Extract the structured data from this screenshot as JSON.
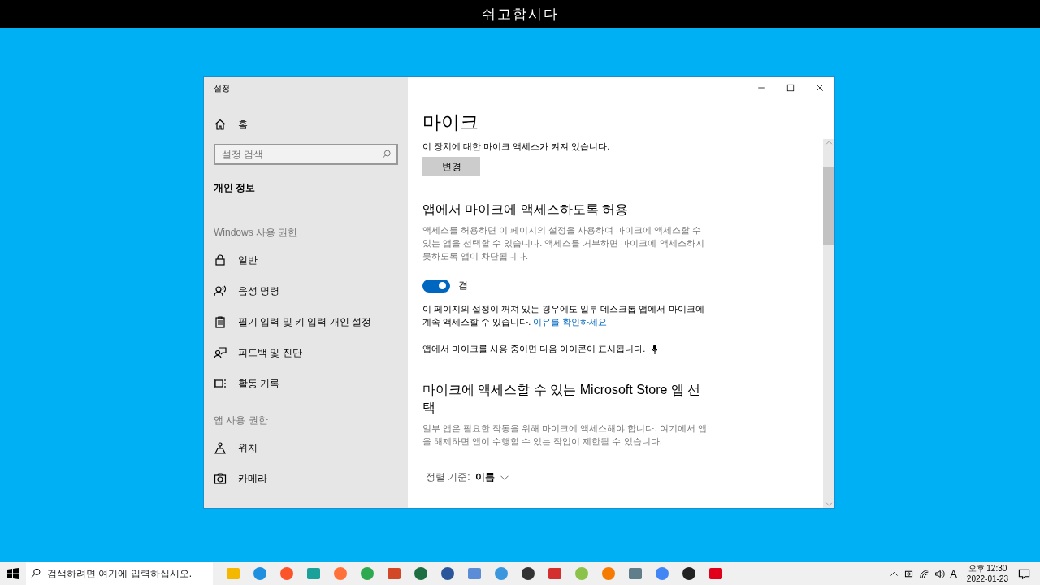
{
  "top_banner": {
    "title": "쉬고합시다"
  },
  "window": {
    "title": "설정",
    "sidebar": {
      "home": {
        "label": "홈",
        "kind": "home"
      },
      "search": {
        "placeholder": "설정 검색"
      },
      "current": "개인 정보",
      "sections": [
        {
          "heading": "Windows 사용 권한",
          "items": [
            {
              "label": "일반",
              "kind": "lock"
            },
            {
              "label": "음성 명령",
              "kind": "speech"
            },
            {
              "label": "필기 입력 및 키 입력 개인 설정",
              "kind": "clipboard"
            },
            {
              "label": "피드백 및 진단",
              "kind": "feedback"
            },
            {
              "label": "활동 기록",
              "kind": "timeline"
            }
          ]
        },
        {
          "heading": "앱 사용 권한",
          "items": [
            {
              "label": "위치",
              "kind": "location"
            },
            {
              "label": "카메라",
              "kind": "camera"
            }
          ]
        }
      ]
    },
    "content": {
      "title": "마이크",
      "device_status": "이 장치에 대한 마이크 액세스가 켜져 있습니다.",
      "change_button": "변경",
      "allow_heading": "앱에서 마이크에 액세스하도록 허용",
      "allow_description": "액세스를 허용하면 이 페이지의 설정을 사용하여 마이크에 액세스할 수 있는 앱을 선택할 수 있습니다. 액세스를 거부하면 마이크에 액세스하지 못하도록 앱이 차단됩니다.",
      "toggle": {
        "on": true,
        "label": "켬"
      },
      "desktop_note": "이 페이지의 설정이 꺼져 있는 경우에도 일부 데스크톱 앱에서 마이크에 계속 액세스할 수 있습니다.",
      "desktop_link": "이유를 확인하세요",
      "icon_note": "앱에서 마이크를 사용 중이면 다음 아이콘이 표시됩니다.",
      "store_heading": "마이크에 액세스할 수 있는 Microsoft Store 앱 선택",
      "store_description": "일부 앱은 필요한 작동을 위해 마이크에 액세스해야 합니다. 여기에서 앱을 해제하면 앱이 수행할 수 있는 작업이 제한될 수 있습니다.",
      "sort": {
        "label": "정렬 기준:",
        "value": "이름"
      }
    }
  },
  "taskbar": {
    "search_placeholder": "검색하려면 여기에 입력하십시오.",
    "tray": {
      "ime": "A",
      "time": "오후 12:30",
      "date": "2022-01-23"
    }
  }
}
